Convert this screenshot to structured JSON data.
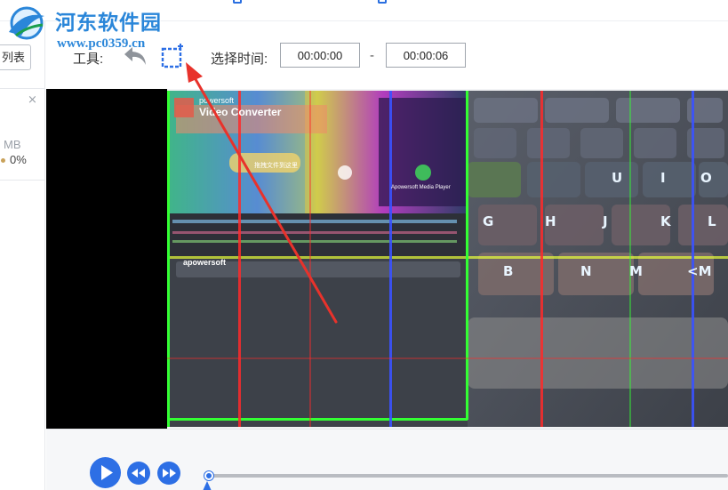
{
  "watermark": {
    "title": "河东软件园",
    "url": "www.pc0359.cn"
  },
  "left_panel": {
    "list_button_label": "列表",
    "close_symbol": "×",
    "file_size_text": "MB",
    "progress_text": "0%"
  },
  "toolbar": {
    "tools_label": "工具:",
    "undo_icon": "undo-arrow-icon",
    "crop_icon": "crop-icon",
    "select_time_label": "选择时间:",
    "start_time": "00:00:00",
    "end_time": "00:00:06",
    "range_separator": "-"
  },
  "video": {
    "overlay_brand": "powersoft",
    "overlay_product": "Video Converter",
    "overlay_subbrand": "apowersoft",
    "overlay_player": "Apowersoft Media Player",
    "overlay_cn_text": "拖拽文件到这里",
    "keys": [
      "U",
      "I",
      "O",
      "G",
      "H",
      "J",
      "K",
      "L",
      "B",
      "N",
      "M",
      "<M"
    ]
  },
  "controls": {
    "play_icon": "play-icon",
    "rewind_icon": "rewind-icon",
    "fast_forward_icon": "fast-forward-icon",
    "progress": 0
  },
  "colors": {
    "accent": "#2d6fe5",
    "watermark": "#2a86d9",
    "annotation": "#e8322b",
    "glitch_green": "#33ff33",
    "glitch_red": "#ff2a2a",
    "glitch_blue": "#3a52ff"
  }
}
